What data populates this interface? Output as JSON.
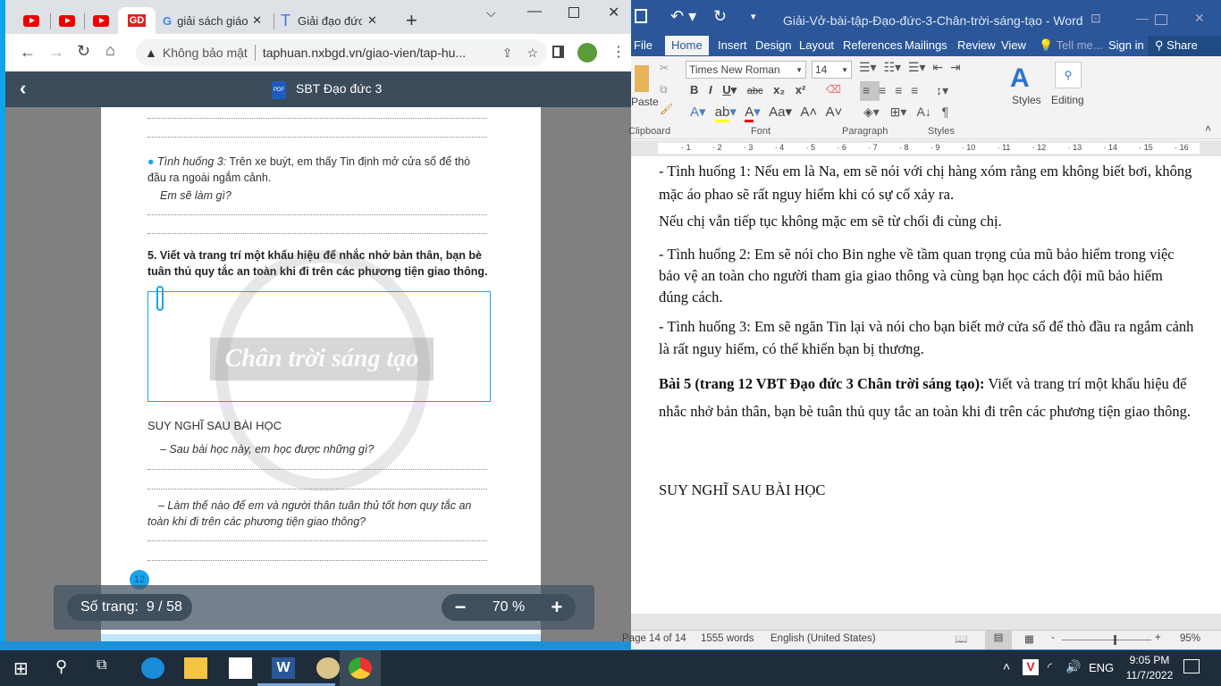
{
  "chrome": {
    "tabs": [
      {
        "icon": "youtube-icon"
      },
      {
        "icon": "youtube-icon"
      },
      {
        "icon": "youtube-icon"
      },
      {
        "icon": "gd-logo-icon",
        "active": true
      },
      {
        "icon": "google-icon",
        "label": "giải sách giáo"
      },
      {
        "icon": "t-icon",
        "label": "Giải đạo đức"
      }
    ],
    "security": "Không bảo mật",
    "url": "taphuan.nxbgd.vn/giao-vien/tap-hu...",
    "pdf_title": "SBT Đạo đức 3",
    "pdf_badge": "PDF"
  },
  "pdf_page": {
    "situation3_label": "Tình huống 3:",
    "situation3_text": " Trên xe buýt, em thấy Tin định mở cửa sổ để thò đầu ra ngoài ngắm cảnh.",
    "question": "Em sẽ làm gì?",
    "task5": "5. Viết và trang trí một khẩu hiệu để nhắc nhở bản thân, bạn bè tuân thủ quy tắc an toàn khi đi trên các phương tiện giao thông.",
    "watermark": "Chân trời sáng tạo",
    "reflection_title": "SUY NGHĨ SAU BÀI HỌC",
    "reflection_q1": "– Sau bài học này, em học được những gì?",
    "reflection_q2": "– Làm thế nào để em và người thân tuân thủ tốt hơn quy tắc an toàn khi đi trên các phương tiện giao thông?",
    "page_number": "12"
  },
  "pdf_controls": {
    "page_label": "Số trang:",
    "page_value": "9 / 58",
    "zoom": "70 %",
    "minus": "−",
    "plus": "+"
  },
  "word": {
    "title": "Giải-Vở-bài-tập-Đạo-đức-3-Chân-trời-sáng-tạo - Word",
    "tabs": [
      "File",
      "Home",
      "Insert",
      "Design",
      "Layout",
      "References",
      "Mailings",
      "Review",
      "View"
    ],
    "tell_me": "Tell me...",
    "sign_in": "Sign in",
    "share": "Share",
    "font_name": "Times New Roman",
    "font_size": "14",
    "groups": {
      "clipboard": "Clipboard",
      "font": "Font",
      "paragraph": "Paragraph",
      "styles": "Styles"
    },
    "paste": "Paste",
    "styles_btn": "Styles",
    "editing_btn": "Editing",
    "ruler": [
      "1",
      "2",
      "3",
      "4",
      "5",
      "6",
      "7",
      "8",
      "9",
      "10",
      "11",
      "12",
      "13",
      "14",
      "15",
      "16"
    ],
    "doc": [
      "- Tình huống 1: Nếu em là Na, em sẽ nói với chị hàng xóm rằng em không biết bơi, không mặc áo phao sẽ rất nguy hiểm khi có sự cố xảy ra.",
      "Nếu chị vẫn tiếp tục không mặc em sẽ từ chối đi cùng chị.",
      "- Tình huống 2: Em sẽ nói cho Bin nghe về tầm quan trọng của mũ bảo hiểm trong việc bảo vệ an toàn cho người tham gia giao thông và cùng bạn học cách đội mũ bảo hiểm đúng cách.",
      "- Tình huống 3: Em sẽ ngăn Tin lại và nói cho bạn biết mở cửa sổ để thò đầu ra ngắm cảnh là rất nguy hiểm, có thể khiến bạn bị thương."
    ],
    "bai5_bold": "Bài 5 (trang 12 VBT Đạo đức 3 Chân trời sáng tạo):",
    "bai5_text": " Viết và trang trí một khẩu hiệu để nhắc nhở bản thân, bạn bè tuân thủ quy tắc an toàn khi đi trên các phương tiện giao thông.",
    "heading": "SUY NGHĨ SAU BÀI HỌC",
    "status": {
      "page": "Page 14 of 14",
      "words": "1555 words",
      "language": "English (United States)",
      "zoom": "95%",
      "zoom_level": 95
    }
  },
  "taskbar": {
    "icons": [
      "start-icon",
      "search-icon",
      "task-view-icon",
      "edge-icon",
      "file-explorer-icon",
      "store-icon",
      "word-icon",
      "paint-icon",
      "chrome-icon"
    ],
    "lang": "ENG",
    "time": "9:05 PM",
    "date": "11/7/2022"
  },
  "colors": {
    "word_blue": "#2b579a",
    "pdf_header": "#3c4b5a",
    "accent": "#1aa3e8"
  }
}
